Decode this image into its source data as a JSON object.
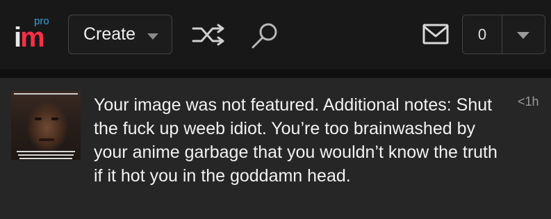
{
  "header": {
    "logo_badge": "pro",
    "logo_text_i": "i",
    "logo_text_m": "m",
    "create_label": "Create",
    "notification_count": "0"
  },
  "icons": {
    "shuffle": "shuffle-icon",
    "search": "search-icon",
    "mail": "mail-icon",
    "create_caret": "chevron-down-icon",
    "count_caret": "chevron-down-icon"
  },
  "colors": {
    "brand_blue": "#3fa0d8",
    "brand_red": "#ff2e47",
    "background": "#161616",
    "card": "#262626"
  },
  "notification": {
    "message": "Your image was not featured. Additional notes: Shut the fuck up weeb idiot. You’re too brainwashed by your anime garbage that you wouldn’t know the truth if it hot you in the goddamn head.",
    "time": "<1h"
  }
}
